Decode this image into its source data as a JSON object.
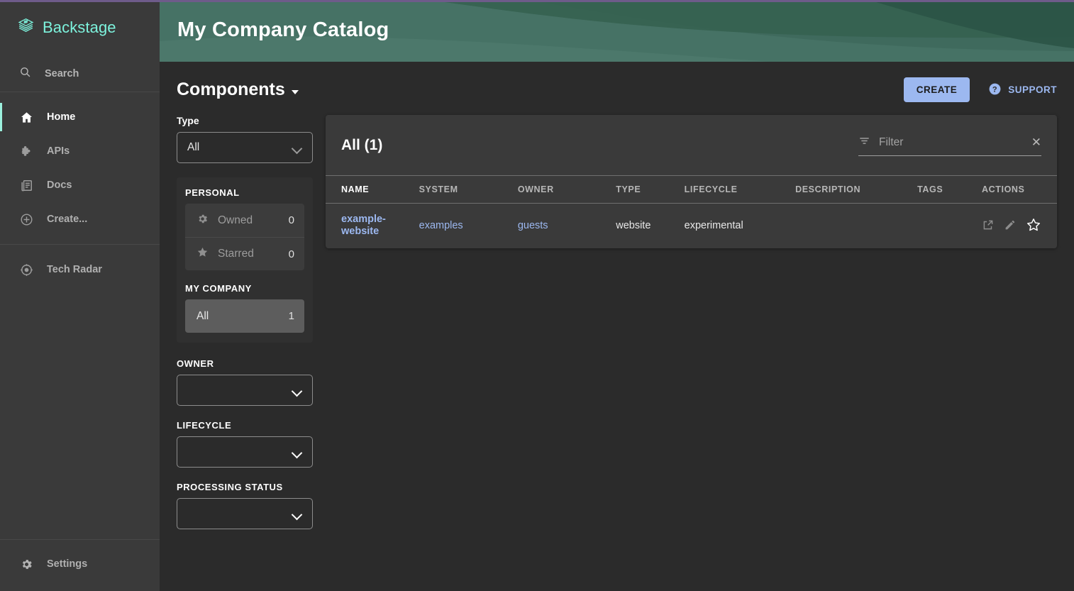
{
  "sidebar": {
    "brand": "Backstage",
    "search_label": "Search",
    "items": [
      {
        "label": "Home",
        "icon": "home-icon",
        "active": true
      },
      {
        "label": "APIs",
        "icon": "puzzle-icon",
        "active": false
      },
      {
        "label": "Docs",
        "icon": "book-icon",
        "active": false
      },
      {
        "label": "Create...",
        "icon": "plus-circle-icon",
        "active": false
      }
    ],
    "secondary_items": [
      {
        "label": "Tech Radar",
        "icon": "radar-icon"
      }
    ],
    "bottom_items": [
      {
        "label": "Settings",
        "icon": "gear-icon"
      }
    ]
  },
  "header": {
    "title": "My Company Catalog"
  },
  "content": {
    "title": "Components",
    "create_label": "CREATE",
    "support_label": "SUPPORT"
  },
  "filters": {
    "type": {
      "label": "Type",
      "value": "All"
    },
    "personal": {
      "label": "PERSONAL",
      "options": [
        {
          "label": "Owned",
          "count": "0",
          "icon": "gear-icon",
          "selected": false
        },
        {
          "label": "Starred",
          "count": "0",
          "icon": "star-icon",
          "selected": false
        }
      ]
    },
    "my_company": {
      "label": "MY COMPANY",
      "options": [
        {
          "label": "All",
          "count": "1",
          "selected": true
        }
      ]
    },
    "owner": {
      "label": "OWNER",
      "value": ""
    },
    "lifecycle": {
      "label": "LIFECYCLE",
      "value": ""
    },
    "processing_status": {
      "label": "PROCESSING STATUS",
      "value": ""
    }
  },
  "table": {
    "title": "All (1)",
    "filter_placeholder": "Filter",
    "clear_label": "✕",
    "columns": [
      "NAME",
      "SYSTEM",
      "OWNER",
      "TYPE",
      "LIFECYCLE",
      "DESCRIPTION",
      "TAGS",
      "ACTIONS"
    ],
    "rows": [
      {
        "name": "example-website",
        "system": "examples",
        "owner": "guests",
        "type": "website",
        "lifecycle": "experimental",
        "description": "",
        "tags": "",
        "actions": [
          "open-in-new-icon",
          "edit-pencil-icon",
          "star-outline-icon"
        ]
      }
    ]
  },
  "colors": {
    "brand_teal": "#7df3dd",
    "accent_blue": "#9cb8f0",
    "header_green": "#3f6a5d",
    "page_bg": "#2b2b2b",
    "surface": "#3a3a3a",
    "top_accent": "#6e5b8a"
  }
}
